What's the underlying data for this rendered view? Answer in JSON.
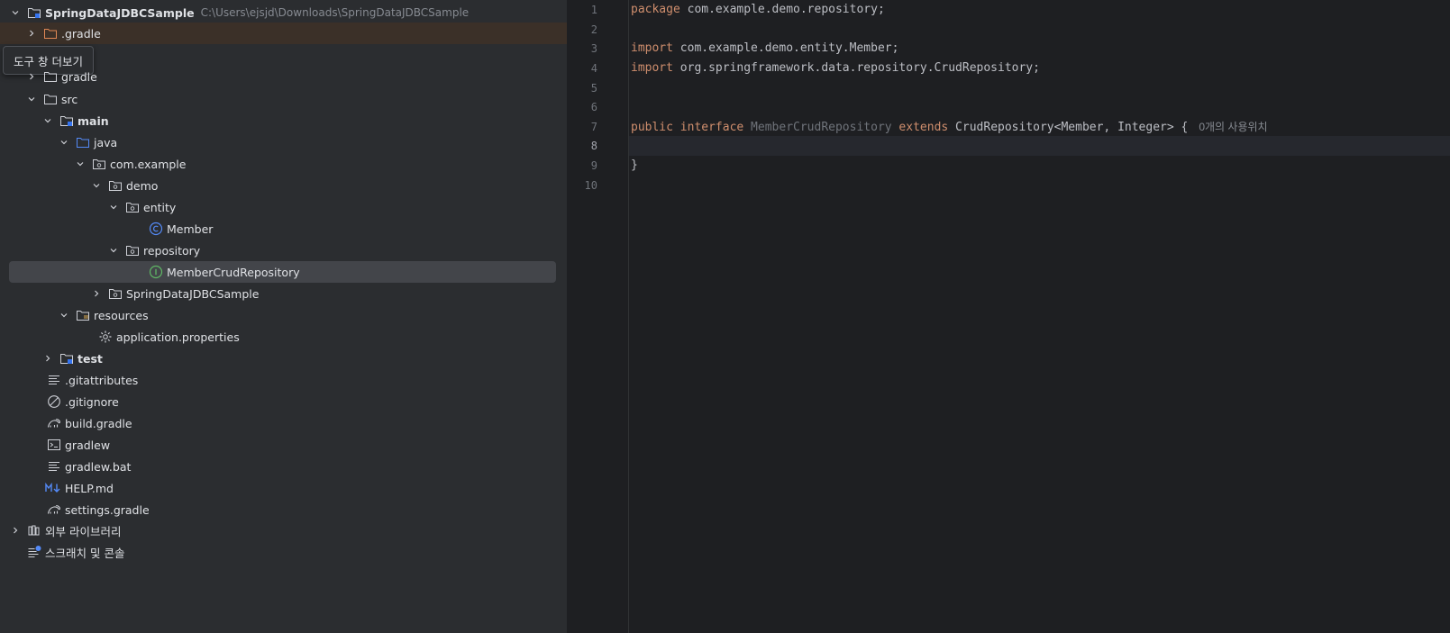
{
  "tooltip": "도구 창 더보기",
  "project_tree": {
    "root": {
      "name": "SpringDataJDBCSample",
      "path": "C:\\Users\\ejsjd\\Downloads\\SpringDataJDBCSample"
    },
    "items": {
      "dot_gradle": ".gradle",
      "gradle": "gradle",
      "src": "src",
      "main": "main",
      "java": "java",
      "com_example": "com.example",
      "demo": "demo",
      "entity": "entity",
      "member": "Member",
      "repository": "repository",
      "member_crud_repository": "MemberCrudRepository",
      "spring_data_jdbc_sample": "SpringDataJDBCSample",
      "resources": "resources",
      "application_properties": "application.properties",
      "test": "test",
      "gitattributes": ".gitattributes",
      "gitignore": ".gitignore",
      "build_gradle": "build.gradle",
      "gradlew": "gradlew",
      "gradlew_bat": "gradlew.bat",
      "help_md": "HELP.md",
      "settings_gradle": "settings.gradle",
      "external_libraries": "외부 라이브러리",
      "scratches": "스크래치 및 콘솔"
    }
  },
  "editor": {
    "line_numbers": [
      "1",
      "2",
      "3",
      "4",
      "5",
      "6",
      "7",
      "8",
      "9",
      "10"
    ],
    "current_line": "8",
    "code": {
      "l1_kw": "package",
      "l1_rest": " com.example.demo.repository;",
      "l3_kw": "import",
      "l3_rest": " com.example.demo.entity.Member;",
      "l4_kw": "import",
      "l4_rest": " org.springframework.data.repository.CrudRepository;",
      "l7_kw1": "public interface",
      "l7_name": " MemberCrudRepository",
      "l7_kw2": " extends",
      "l7_rest": " CrudRepository<Member, Integer> {",
      "l7_hint": "0개의 사용위치",
      "l9": "}"
    }
  },
  "colors": {
    "keyword": "#cf8e6d",
    "unused_symbol": "#6f737a",
    "selection": "#43454a"
  }
}
